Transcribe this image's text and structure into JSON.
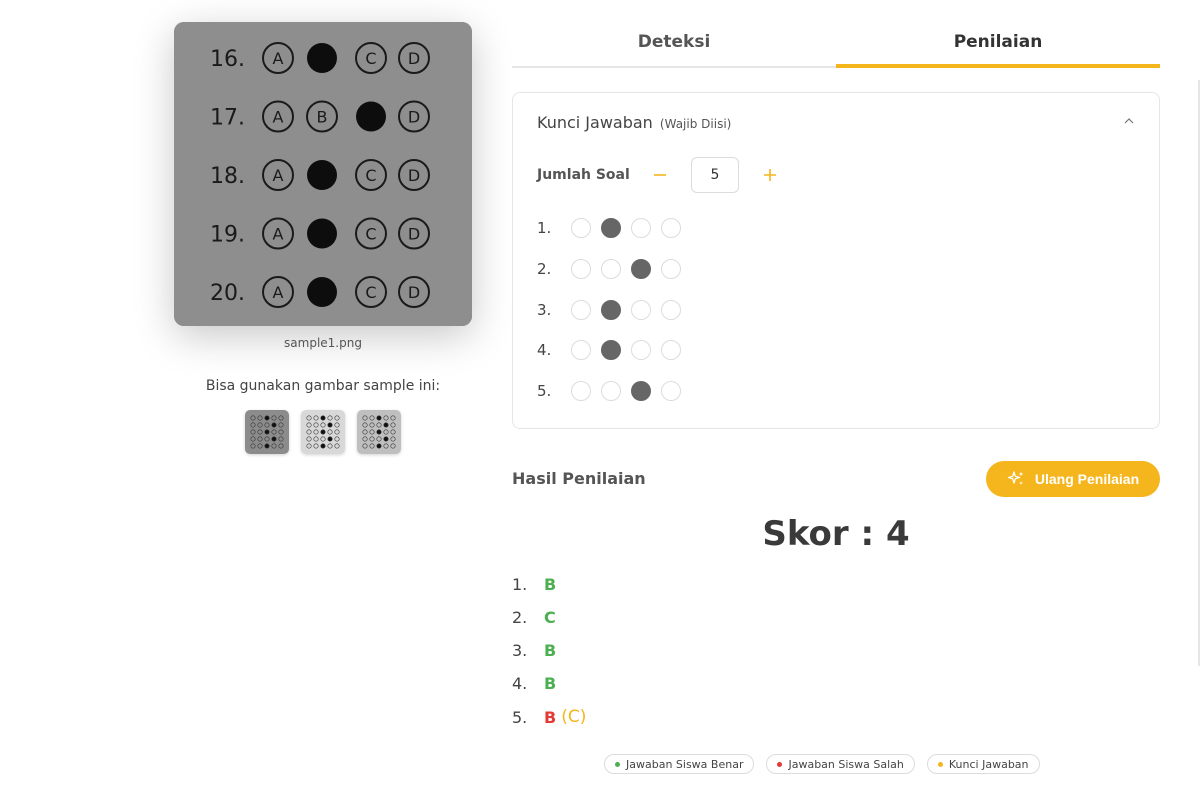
{
  "preview": {
    "filename": "sample1.png",
    "rows": [
      {
        "num": "16.",
        "letters": [
          "A",
          "",
          "C",
          "D"
        ]
      },
      {
        "num": "17.",
        "letters": [
          "A",
          "B",
          "",
          "D"
        ]
      },
      {
        "num": "18.",
        "letters": [
          "A",
          "",
          "C",
          "D"
        ]
      },
      {
        "num": "19.",
        "letters": [
          "A",
          "",
          "C",
          "D"
        ]
      },
      {
        "num": "20.",
        "letters": [
          "A",
          "",
          "C",
          "D"
        ]
      }
    ]
  },
  "samples": {
    "hint": "Bisa gunakan gambar sample ini:",
    "count": 3
  },
  "tabs": [
    {
      "label": "Deteksi",
      "active": false
    },
    {
      "label": "Penilaian",
      "active": true
    }
  ],
  "answer_key": {
    "title": "Kunci Jawaban",
    "note": "(Wajib Diisi)",
    "count_label": "Jumlah Soal",
    "count_value": "5",
    "rows": [
      {
        "num": "1.",
        "selected": 1
      },
      {
        "num": "2.",
        "selected": 2
      },
      {
        "num": "3.",
        "selected": 1
      },
      {
        "num": "4.",
        "selected": 1
      },
      {
        "num": "5.",
        "selected": 2
      }
    ]
  },
  "results": {
    "title": "Hasil Penilaian",
    "regrade_label": "Ulang Penilaian",
    "score_text": "Skor : 4",
    "items": [
      {
        "num": "1.",
        "answer": "B",
        "correct": true,
        "key": ""
      },
      {
        "num": "2.",
        "answer": "C",
        "correct": true,
        "key": ""
      },
      {
        "num": "3.",
        "answer": "B",
        "correct": true,
        "key": ""
      },
      {
        "num": "4.",
        "answer": "B",
        "correct": true,
        "key": ""
      },
      {
        "num": "5.",
        "answer": "B",
        "correct": false,
        "key": "(C)"
      }
    ]
  },
  "legend": [
    {
      "label": "Jawaban Siswa Benar",
      "color": "#4caf50"
    },
    {
      "label": "Jawaban Siswa Salah",
      "color": "#e53935"
    },
    {
      "label": "Kunci Jawaban",
      "color": "#f5b51c"
    }
  ],
  "colors": {
    "accent": "#f5b51c",
    "correct": "#4caf50",
    "wrong": "#e53935",
    "selected": "#666666"
  }
}
